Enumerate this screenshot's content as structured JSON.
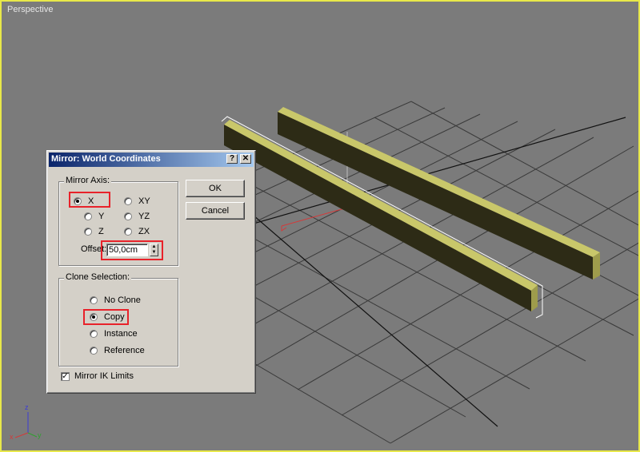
{
  "viewport": {
    "label": "Perspective"
  },
  "gizmo": {
    "z": "z",
    "x": "x",
    "y": "y"
  },
  "dialog": {
    "title": "Mirror: World Coordinates",
    "help_label": "?",
    "close_label": "✕",
    "mirror_axis": {
      "label": "Mirror Axis:",
      "options": [
        "X",
        "XY",
        "Y",
        "YZ",
        "Z",
        "ZX"
      ],
      "selected": "X",
      "offset_label": "Offset:",
      "offset_value": "50,0cm"
    },
    "clone_selection": {
      "label": "Clone Selection:",
      "options": [
        "No Clone",
        "Copy",
        "Instance",
        "Reference"
      ],
      "selected": "Copy"
    },
    "mirror_ik_limits": {
      "label": "Mirror IK Limits",
      "checked": true
    },
    "ok_label": "OK",
    "cancel_label": "Cancel"
  },
  "colors": {
    "viewport_border": "#e8e84a",
    "highlight": "#e8222a",
    "title_bar": "#0a246a",
    "beam_body": "#2d2b16",
    "beam_top": "#c9c76a"
  }
}
